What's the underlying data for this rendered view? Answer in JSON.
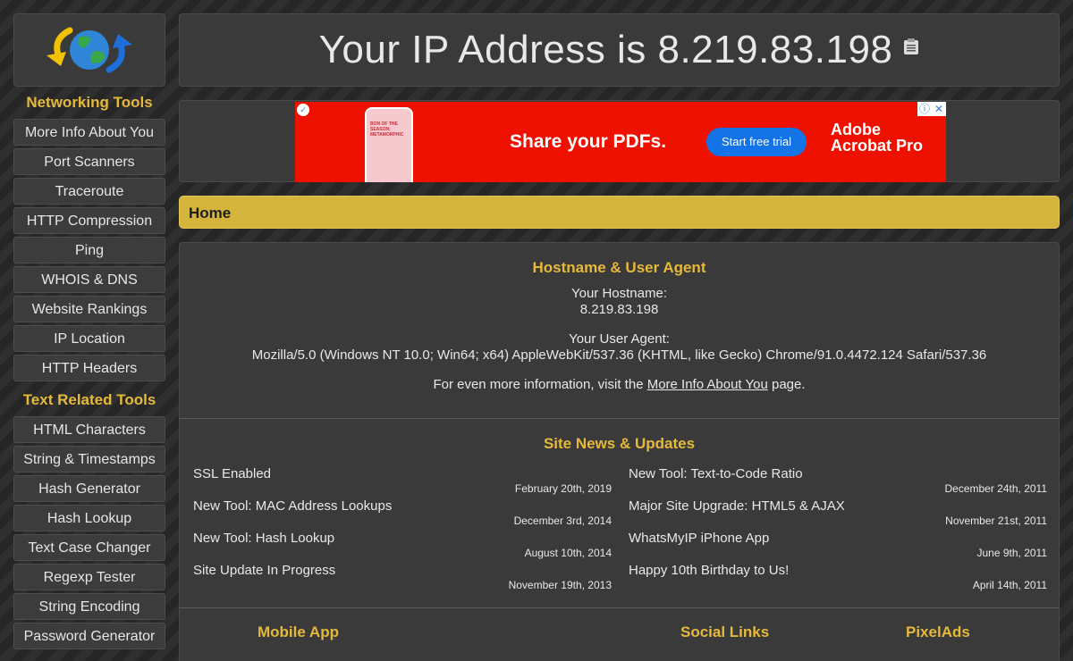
{
  "header": {
    "prefix": "Your IP Address is",
    "ip": "8.219.83.198",
    "copy_icon": "clipboard-icon"
  },
  "logo": {
    "icon": "globe-arrows-icon"
  },
  "sidebar": {
    "networking_title": "Networking Tools",
    "networking_items": [
      {
        "label": "More Info About You"
      },
      {
        "label": "Port Scanners"
      },
      {
        "label": "Traceroute"
      },
      {
        "label": "HTTP Compression"
      },
      {
        "label": "Ping"
      },
      {
        "label": "WHOIS & DNS"
      },
      {
        "label": "Website Rankings"
      },
      {
        "label": "IP Location"
      },
      {
        "label": "HTTP Headers"
      }
    ],
    "text_title": "Text Related Tools",
    "text_items": [
      {
        "label": "HTML Characters"
      },
      {
        "label": "String & Timestamps"
      },
      {
        "label": "Hash Generator"
      },
      {
        "label": "Hash Lookup"
      },
      {
        "label": "Text Case Changer"
      },
      {
        "label": "Regexp Tester"
      },
      {
        "label": "String Encoding"
      },
      {
        "label": "Password Generator"
      }
    ]
  },
  "ad": {
    "headline": "Share your PDFs.",
    "cta": "Start free trial",
    "brand_line1": "Adobe",
    "brand_line2": "Acrobat Pro",
    "phone_text": "BON OF THE SEASON: METAMORPHIC",
    "colors": {
      "background": "#ee1100",
      "cta": "#1473e6"
    }
  },
  "breadcrumb": {
    "label": "Home"
  },
  "hostname_section": {
    "title": "Hostname & User Agent",
    "hostname_label": "Your Hostname:",
    "hostname_value": "8.219.83.198",
    "ua_label": "Your User Agent:",
    "ua_value": "Mozilla/5.0 (Windows NT 10.0; Win64; x64) AppleWebKit/537.36 (KHTML, like Gecko) Chrome/91.0.4472.124 Safari/537.36",
    "more_prefix": "For even more information, visit the",
    "more_link": "More Info About You",
    "more_suffix": "page."
  },
  "news": {
    "title": "Site News & Updates",
    "left": [
      {
        "title": "SSL Enabled",
        "date": "February 20th, 2019"
      },
      {
        "title": "New Tool: MAC Address Lookups",
        "date": "December 3rd, 2014"
      },
      {
        "title": "New Tool: Hash Lookup",
        "date": "August 10th, 2014"
      },
      {
        "title": "Site Update In Progress",
        "date": "November 19th, 2013"
      }
    ],
    "right": [
      {
        "title": "New Tool: Text-to-Code Ratio",
        "date": "December 24th, 2011"
      },
      {
        "title": "Major Site Upgrade: HTML5 & AJAX",
        "date": "November 21st, 2011"
      },
      {
        "title": "WhatsMyIP iPhone App",
        "date": "June 9th, 2011"
      },
      {
        "title": "Happy 10th Birthday to Us!",
        "date": "April 14th, 2011"
      }
    ]
  },
  "footer": {
    "mobile": "Mobile App",
    "social": "Social Links",
    "pixelads": "PixelAds"
  },
  "colors": {
    "accent": "#e6b93a",
    "breadcrumb": "#d4b43a",
    "panel": "#3a3a3a"
  }
}
